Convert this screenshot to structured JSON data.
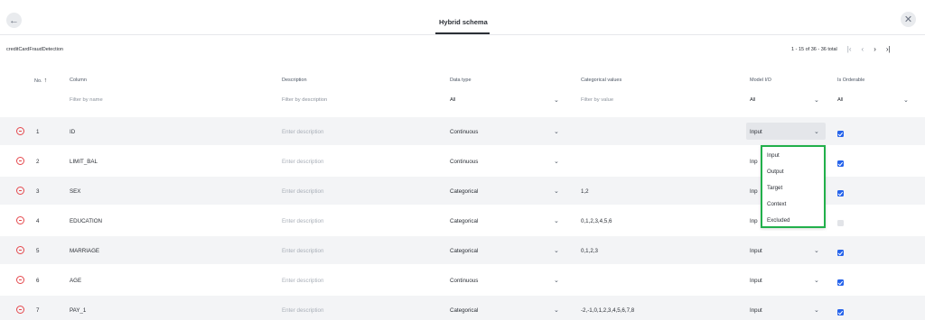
{
  "header": {
    "title": "Hybrid schema"
  },
  "dataset": {
    "name": "creditCardFraudDetection"
  },
  "pagination": {
    "summary": "1 - 15 of 36 - 36 total"
  },
  "columns": {
    "no": "No.",
    "column": "Column",
    "description": "Description",
    "data_type": "Data type",
    "categorical": "Categorical values",
    "model_io": "Model I/O",
    "orderable": "Is Orderable"
  },
  "filters": {
    "name_placeholder": "Filter by name",
    "description_placeholder": "Filter by description",
    "data_type": "All",
    "value_placeholder": "Filter by value",
    "model_io": "All",
    "orderable": "All"
  },
  "rows": [
    {
      "no": "1",
      "column": "ID",
      "description": "Enter description",
      "data_type": "Continuous",
      "categorical": "",
      "model_io": "Input",
      "orderable": true
    },
    {
      "no": "2",
      "column": "LIMIT_BAL",
      "description": "Enter description",
      "data_type": "Continuous",
      "categorical": "",
      "model_io": "Inp",
      "orderable": true
    },
    {
      "no": "3",
      "column": "SEX",
      "description": "Enter description",
      "data_type": "Categorical",
      "categorical": "1,2",
      "model_io": "Inp",
      "orderable": true
    },
    {
      "no": "4",
      "column": "EDUCATION",
      "description": "Enter description",
      "data_type": "Categorical",
      "categorical": "0,1,2,3,4,5,6",
      "model_io": "Inp",
      "orderable": false
    },
    {
      "no": "5",
      "column": "MARRIAGE",
      "description": "Enter description",
      "data_type": "Categorical",
      "categorical": "0,1,2,3",
      "model_io": "Input",
      "orderable": true
    },
    {
      "no": "6",
      "column": "AGE",
      "description": "Enter description",
      "data_type": "Continuous",
      "categorical": "",
      "model_io": "Input",
      "orderable": true
    },
    {
      "no": "7",
      "column": "PAY_1",
      "description": "Enter description",
      "data_type": "Categorical",
      "categorical": "-2,-1,0,1,2,3,4,5,6,7,8",
      "model_io": "Input",
      "orderable": true
    }
  ],
  "dropdown": {
    "options": [
      "Input",
      "Output",
      "Target",
      "Context",
      "Excluded"
    ]
  },
  "colors": {
    "accent": "#2563eb",
    "remove": "#e5484d",
    "highlight": "#22b04b"
  }
}
